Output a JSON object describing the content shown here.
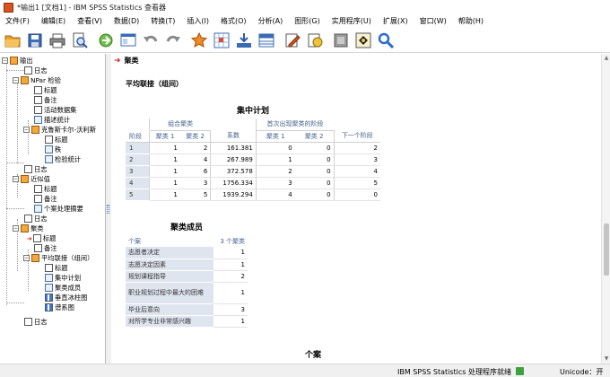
{
  "window": {
    "title": "*输出1 [文档1] - IBM SPSS Statistics 查看器"
  },
  "menu": [
    "文件(F)",
    "编辑(E)",
    "查看(V)",
    "数据(D)",
    "转换(T)",
    "插入(I)",
    "格式(O)",
    "分析(A)",
    "图形(G)",
    "实用程序(U)",
    "扩展(X)",
    "窗口(W)",
    "帮助(H)"
  ],
  "toolbar": {
    "icons": [
      "open-folder-icon",
      "save-icon",
      "print-icon",
      "print-preview-icon",
      "export-icon",
      "recall-dialog-icon",
      "undo-icon",
      "redo-icon",
      "goto-data-icon",
      "goto-case-icon",
      "goto-variable-icon",
      "variables-icon",
      "edit-icon",
      "designate-window-icon",
      "show-hidden-icon",
      "insert-output-icon",
      "search-icon"
    ]
  },
  "outline": {
    "root": "输出",
    "log1": "日志",
    "npar": "NPar 检验",
    "npar_title": "标题",
    "npar_notes": "备注",
    "npar_dataset": "活动数据集",
    "npar_desc": "描述统计",
    "kw": "克鲁斯卡尔-沃利斯",
    "kw_title": "标题",
    "kw_rank": "秩",
    "kw_test": "检验统计",
    "log2": "日志",
    "prox": "近似值",
    "prox_title": "标题",
    "prox_notes": "备注",
    "prox_summary": "个案处理摘要",
    "log3": "日志",
    "cluster": "聚类",
    "cl_title": "标题",
    "cl_notes": "备注",
    "cl_avg": "平均联接（组间）",
    "avg_title": "标题",
    "avg_schedule": "集中计划",
    "avg_member": "聚类成员",
    "avg_icicle": "垂直冰柱图",
    "avg_dendro": "谱系图",
    "log4": "日志"
  },
  "content": {
    "heading": "聚类",
    "method": "平均联接（组间）",
    "schedule": {
      "caption": "集中计划",
      "stage_label": "阶段",
      "combined": "组合聚类",
      "coef": "系数",
      "first_appear": "首次出现聚类的阶段",
      "c1": "聚类 1",
      "c2": "聚类 2",
      "next": "下一个阶段",
      "rows": [
        [
          "1",
          "1",
          "2",
          "161.381",
          "0",
          "0",
          "2"
        ],
        [
          "2",
          "1",
          "4",
          "267.989",
          "1",
          "0",
          "3"
        ],
        [
          "3",
          "1",
          "6",
          "372.578",
          "2",
          "0",
          "4"
        ],
        [
          "4",
          "1",
          "3",
          "1756.334",
          "3",
          "0",
          "5"
        ],
        [
          "5",
          "1",
          "5",
          "1939.294",
          "4",
          "0",
          "0"
        ]
      ]
    },
    "membership": {
      "caption": "聚类成员",
      "case_label": "个案",
      "clusters_label": "3 个聚类",
      "rows": [
        [
          "志愿者决定",
          "1"
        ],
        [
          "志愿决定因素",
          "1"
        ],
        [
          "规划课程指导",
          "2"
        ],
        [
          "职业规划过程中最大的困难",
          "1"
        ],
        [
          "毕业后意向",
          "3"
        ],
        [
          "对所学专业非常感兴趣",
          "1"
        ]
      ]
    },
    "next_section": "个案"
  },
  "status": {
    "processor": "IBM SPSS Statistics 处理程序就绪",
    "unicode": "Unicode：开"
  }
}
